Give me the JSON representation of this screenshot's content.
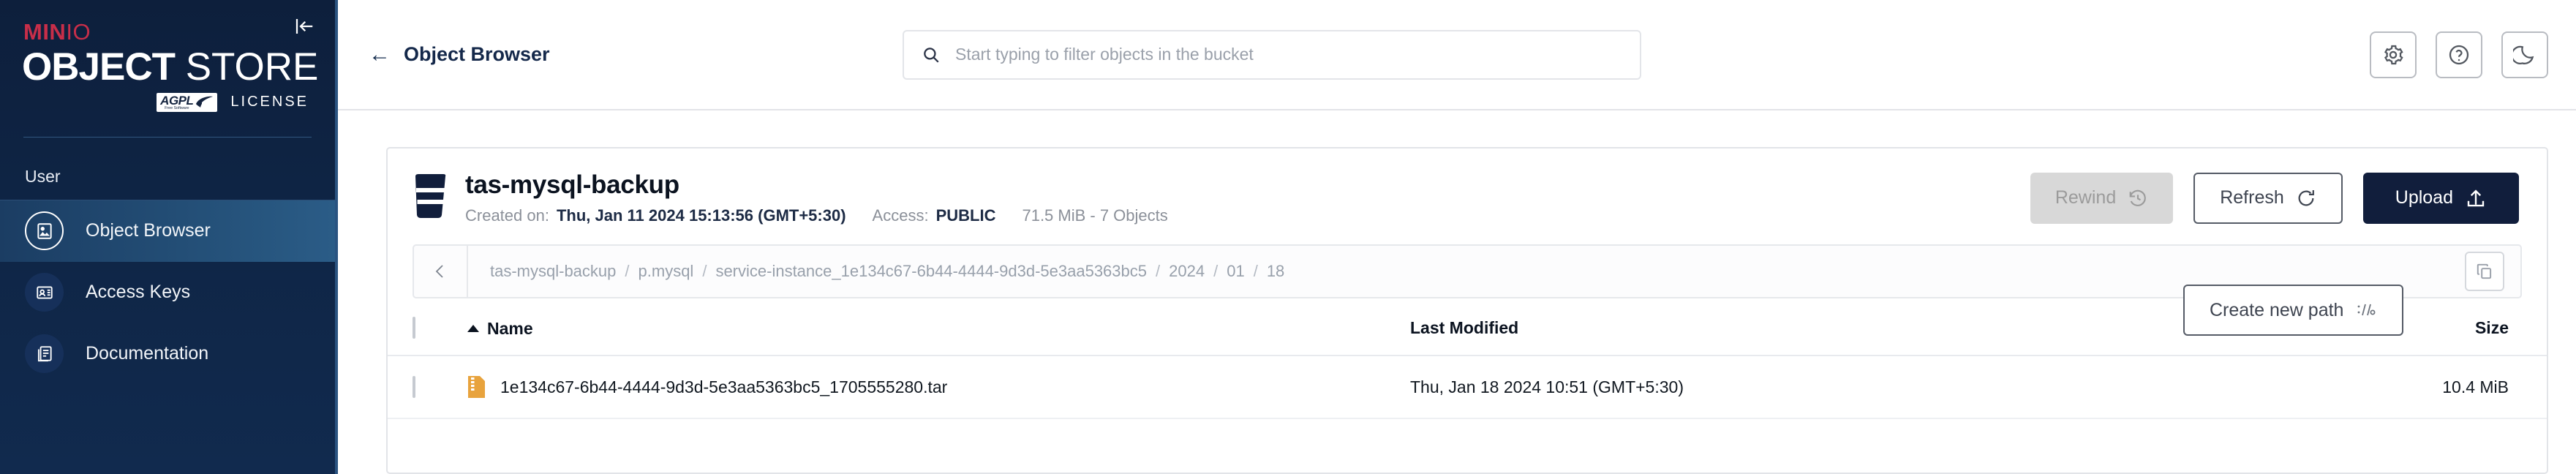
{
  "sidebar": {
    "logo": {
      "min": "MIN",
      "io": "IO",
      "object": "OBJECT",
      "store": " STORE",
      "agpl_main": "AGPL",
      "agpl_sub": "Free Software",
      "license": "LICENSE"
    },
    "section_label": "User",
    "collapse_icon": "collapse-sidebar-icon",
    "items": [
      {
        "label": "Object Browser",
        "icon": "object-browser-icon",
        "active": true
      },
      {
        "label": "Access Keys",
        "icon": "access-keys-icon",
        "active": false
      },
      {
        "label": "Documentation",
        "icon": "documentation-icon",
        "active": false
      }
    ]
  },
  "topbar": {
    "back_icon": "back-arrow-icon",
    "title": "Object Browser",
    "search": {
      "icon": "search-icon",
      "value": "",
      "placeholder": "Start typing to filter objects in the bucket"
    },
    "actions": [
      {
        "name": "settings-button",
        "icon": "gear-icon"
      },
      {
        "name": "help-button",
        "icon": "question-circle-icon"
      },
      {
        "name": "dark-mode-button",
        "icon": "moon-icon"
      }
    ]
  },
  "bucket": {
    "icon": "bucket-icon",
    "name": "tas-mysql-backup",
    "created_label": "Created on:",
    "created_value": "Thu, Jan 11 2024 15:13:56 (GMT+5:30)",
    "access_label": "Access:",
    "access_value": "PUBLIC",
    "size_summary": "71.5 MiB - 7 Objects",
    "buttons": {
      "rewind": "Rewind",
      "rewind_icon": "rewind-clock-icon",
      "rewind_disabled": true,
      "refresh": "Refresh",
      "refresh_icon": "refresh-icon",
      "upload": "Upload",
      "upload_icon": "upload-icon"
    }
  },
  "path": {
    "back_icon": "chevron-left-icon",
    "crumbs": [
      "tas-mysql-backup",
      "p.mysql",
      "service-instance_1e134c67-6b44-4444-9d3d-5e3aa5363bc5",
      "2024",
      "01",
      "18"
    ],
    "separator": "/",
    "copy_icon": "copy-icon",
    "create_new_path": "Create new path",
    "create_new_path_icon": "path-icon"
  },
  "table": {
    "columns": {
      "name": "Name",
      "last_modified": "Last Modified",
      "size": "Size"
    },
    "sort_icon": "sort-ascending-icon",
    "rows": [
      {
        "icon": "tar-archive-icon",
        "name": "1e134c67-6b44-4444-9d3d-5e3aa5363bc5_1705555280.tar",
        "last_modified": "Thu, Jan 18 2024 10:51 (GMT+5:30)",
        "size": "10.4 MiB"
      }
    ]
  },
  "colors": {
    "sidebar_navy": "#0f2647",
    "brand_red": "#c72e49",
    "accent_navy": "#111e3c",
    "archive_orange": "#e8a33d",
    "active_nav": "#27567f"
  }
}
